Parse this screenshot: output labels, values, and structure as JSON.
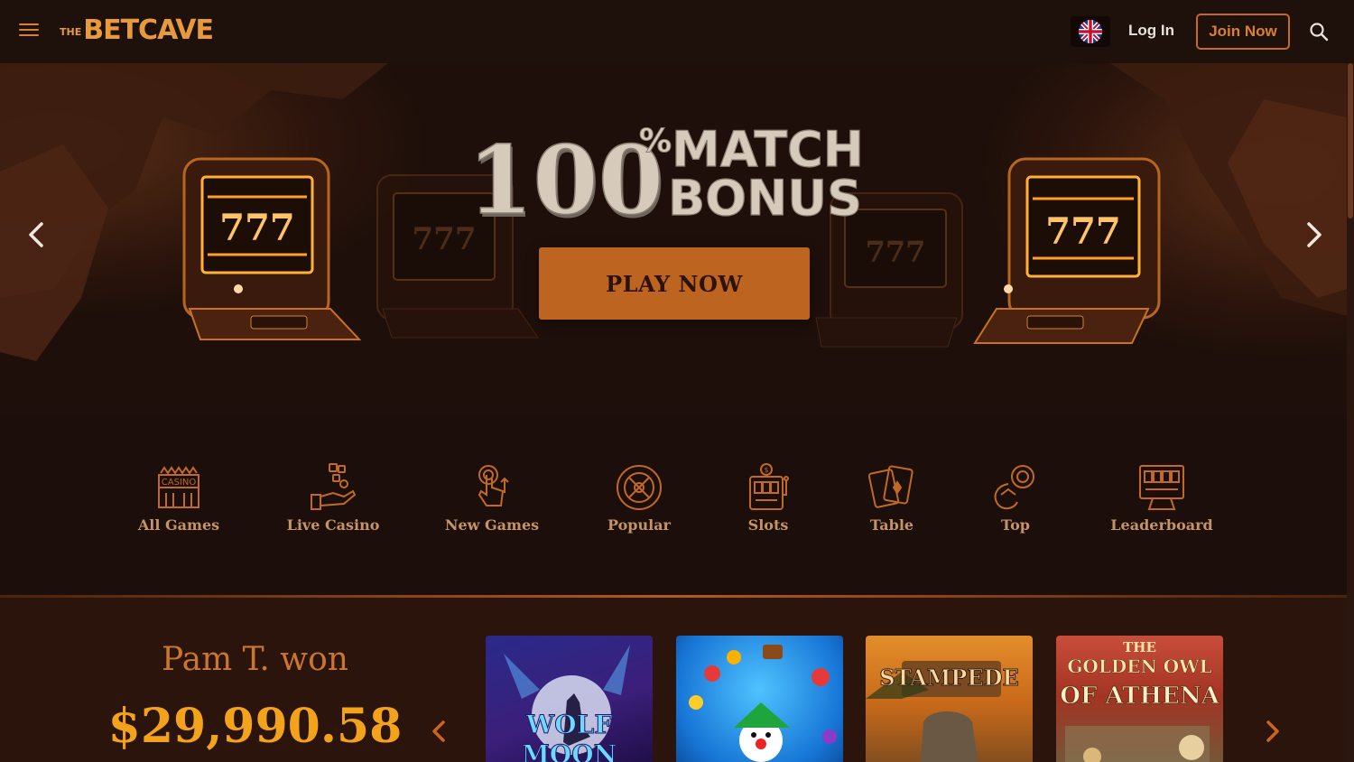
{
  "header": {
    "logo_prefix": "THE",
    "logo_text": "BETCAVE",
    "login_label": "Log In",
    "join_label": "Join Now",
    "language_flag": "uk-flag-icon",
    "menu_icon": "hamburger-menu-icon",
    "search_icon": "search-icon"
  },
  "hero": {
    "headline_number": "100",
    "headline_percent": "%",
    "headline_line1": "MATCH",
    "headline_line2": "BONUS",
    "cta_label": "PLAY NOW",
    "slot_reels": "777",
    "prev_icon": "chevron-left-icon",
    "next_icon": "chevron-right-icon"
  },
  "categories": [
    {
      "label": "All Games",
      "icon": "casino-building-icon"
    },
    {
      "label": "Live Casino",
      "icon": "dealer-hand-dice-icon"
    },
    {
      "label": "New Games",
      "icon": "touch-hand-icon"
    },
    {
      "label": "Popular",
      "icon": "roulette-wheel-icon"
    },
    {
      "label": "Slots",
      "icon": "slot-machine-icon"
    },
    {
      "label": "Table",
      "icon": "playing-cards-icon"
    },
    {
      "label": "Top",
      "icon": "medal-icon"
    },
    {
      "label": "Leaderboard",
      "icon": "scoreboard-icon"
    }
  ],
  "winners": {
    "name_line": "Pam T. won",
    "amount": "$29,990.58",
    "games": [
      {
        "title": "WOLF MOON"
      },
      {
        "title": ""
      },
      {
        "title": "STAMPEDE"
      },
      {
        "title_line1": "THE",
        "title_line2": "GOLDEN OWL",
        "title_line3": "OF ATHENA"
      }
    ]
  },
  "colors": {
    "accent": "#bc6420",
    "gold": "#f2a31b",
    "background": "#1c0e0a"
  }
}
